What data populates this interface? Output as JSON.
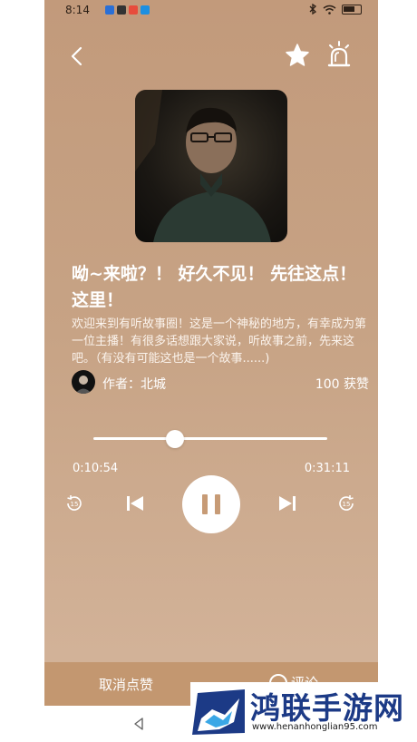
{
  "status_bar": {
    "time": "8:14"
  },
  "header": {
    "back_icon": "chevron-left-icon",
    "favorite_icon": "star-icon",
    "alarm_icon": "alarm-icon"
  },
  "episode": {
    "title": "呦~来啦？！ 好久不见！ 先往这点！这里！",
    "description": "欢迎来到有听故事圈！这是一个神秘的地方，有幸成为第一位主播！有很多话想跟大家说，听故事之前，先来这吧。（有没有可能这也是一个故事......)",
    "author": "作者：北城",
    "likes": "100 获赞"
  },
  "player": {
    "current_time": "0:10:54",
    "total_time": "0:31:11",
    "progress": 0.35,
    "skip_back_label": "15",
    "skip_forward_label": "15"
  },
  "bottom_bar": {
    "unlike_label": "取消点赞",
    "comment_label": "评论"
  },
  "watermark": {
    "brand": "鸿联手游网",
    "url": "www.henanhonglian95.com"
  },
  "colors": {
    "background": "#c29a7b",
    "bottom_bar": "#c39770",
    "pause_icon": "#c79b76",
    "watermark_blue": "#1c3a86"
  }
}
